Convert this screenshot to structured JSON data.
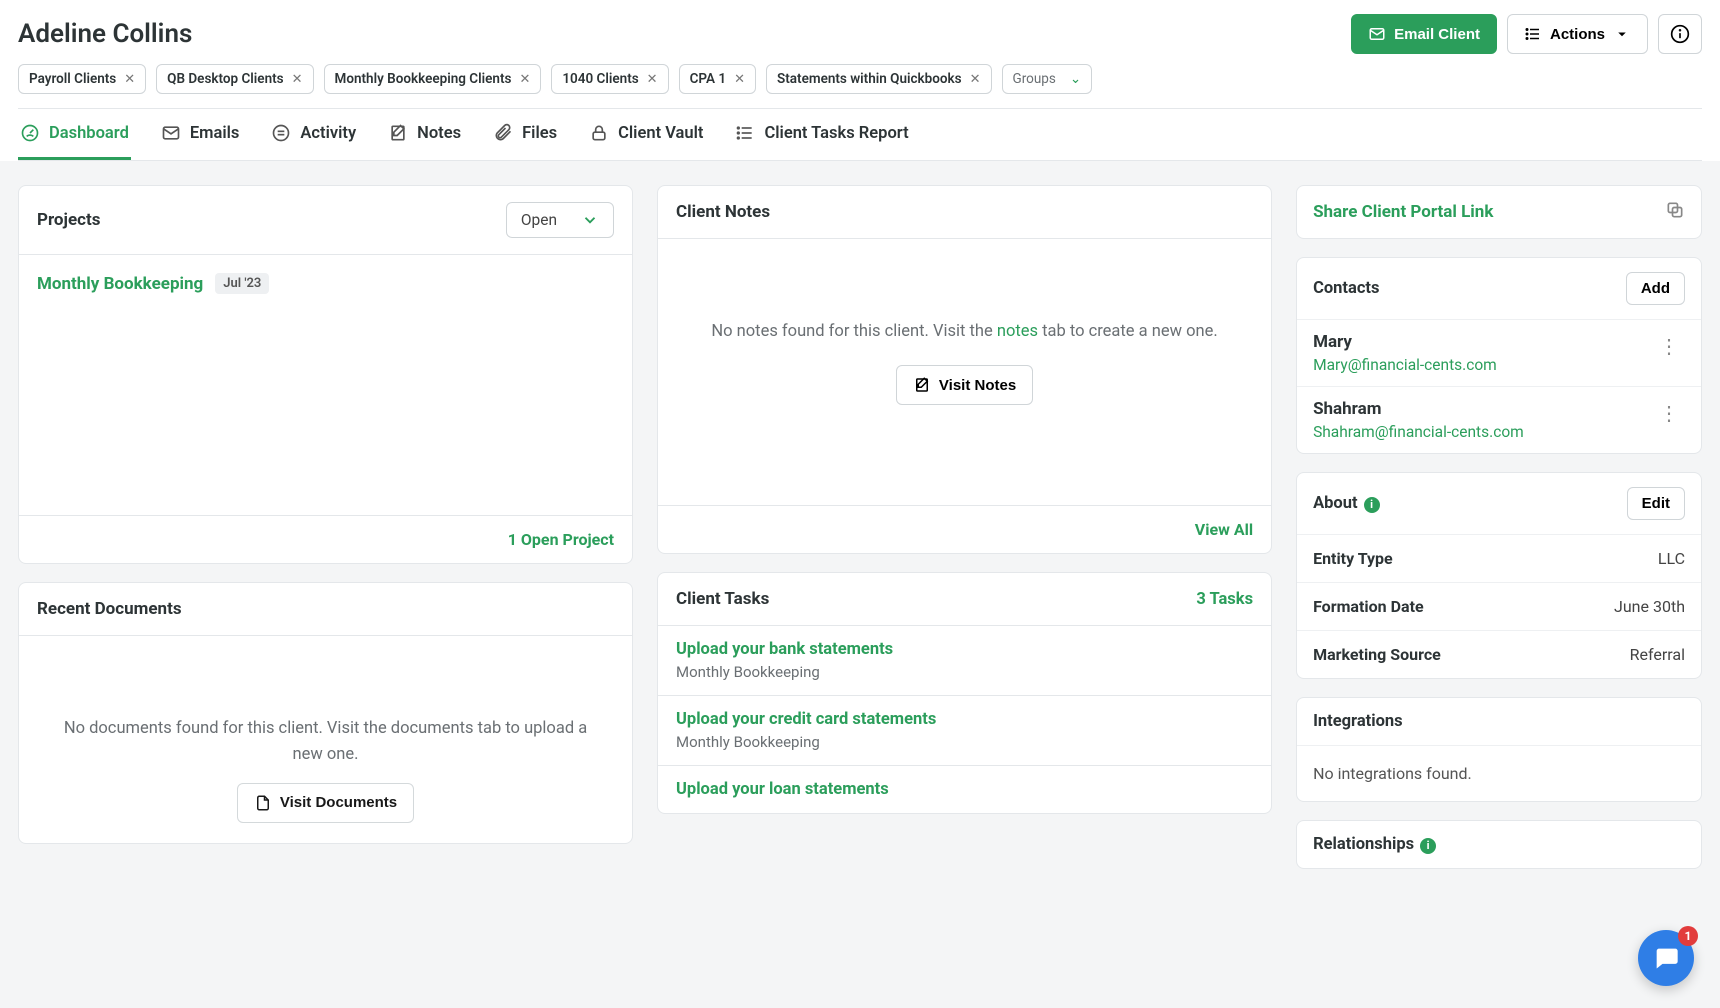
{
  "client_name": "Adeline Collins",
  "header": {
    "email_client": "Email Client",
    "actions": "Actions"
  },
  "chips": [
    "Payroll Clients",
    "QB Desktop Clients",
    "Monthly Bookkeeping Clients",
    "1040 Clients",
    "CPA 1",
    "Statements within Quickbooks"
  ],
  "groups_label": "Groups",
  "tabs": [
    {
      "label": "Dashboard"
    },
    {
      "label": "Emails"
    },
    {
      "label": "Activity"
    },
    {
      "label": "Notes"
    },
    {
      "label": "Files"
    },
    {
      "label": "Client Vault"
    },
    {
      "label": "Client Tasks Report"
    }
  ],
  "projects": {
    "title": "Projects",
    "filter": "Open",
    "items": [
      {
        "name": "Monthly Bookkeeping",
        "period": "Jul '23"
      }
    ],
    "footer": "1 Open Project"
  },
  "client_notes": {
    "title": "Client Notes",
    "empty_pre": "No notes found for this client. Visit the ",
    "empty_link": "notes",
    "empty_post": " tab to create a new one.",
    "visit": "Visit Notes",
    "footer": "View All"
  },
  "recent_docs": {
    "title": "Recent Documents",
    "empty_pre": "No documents found for this client. Visit the ",
    "empty_link": "documents",
    "empty_post": " tab to upload a new one.",
    "visit": "Visit Documents"
  },
  "client_tasks": {
    "title": "Client Tasks",
    "count": "3 Tasks",
    "items": [
      {
        "title": "Upload your bank statements",
        "sub": "Monthly Bookkeeping"
      },
      {
        "title": "Upload your credit card statements",
        "sub": "Monthly Bookkeeping"
      },
      {
        "title": "Upload your loan statements",
        "sub": ""
      }
    ]
  },
  "sidebar": {
    "share": "Share Client Portal Link",
    "contacts": {
      "title": "Contacts",
      "add": "Add",
      "items": [
        {
          "name": "Mary",
          "email": "Mary@financial-cents.com"
        },
        {
          "name": "Shahram",
          "email": "Shahram@financial-cents.com"
        }
      ]
    },
    "about": {
      "title": "About",
      "edit": "Edit",
      "rows": [
        {
          "k": "Entity Type",
          "v": "LLC"
        },
        {
          "k": "Formation Date",
          "v": "June 30th"
        },
        {
          "k": "Marketing Source",
          "v": "Referral"
        }
      ]
    },
    "integrations": {
      "title": "Integrations",
      "empty": "No integrations found."
    },
    "relationships": {
      "title": "Relationships"
    }
  },
  "fab_count": "1"
}
